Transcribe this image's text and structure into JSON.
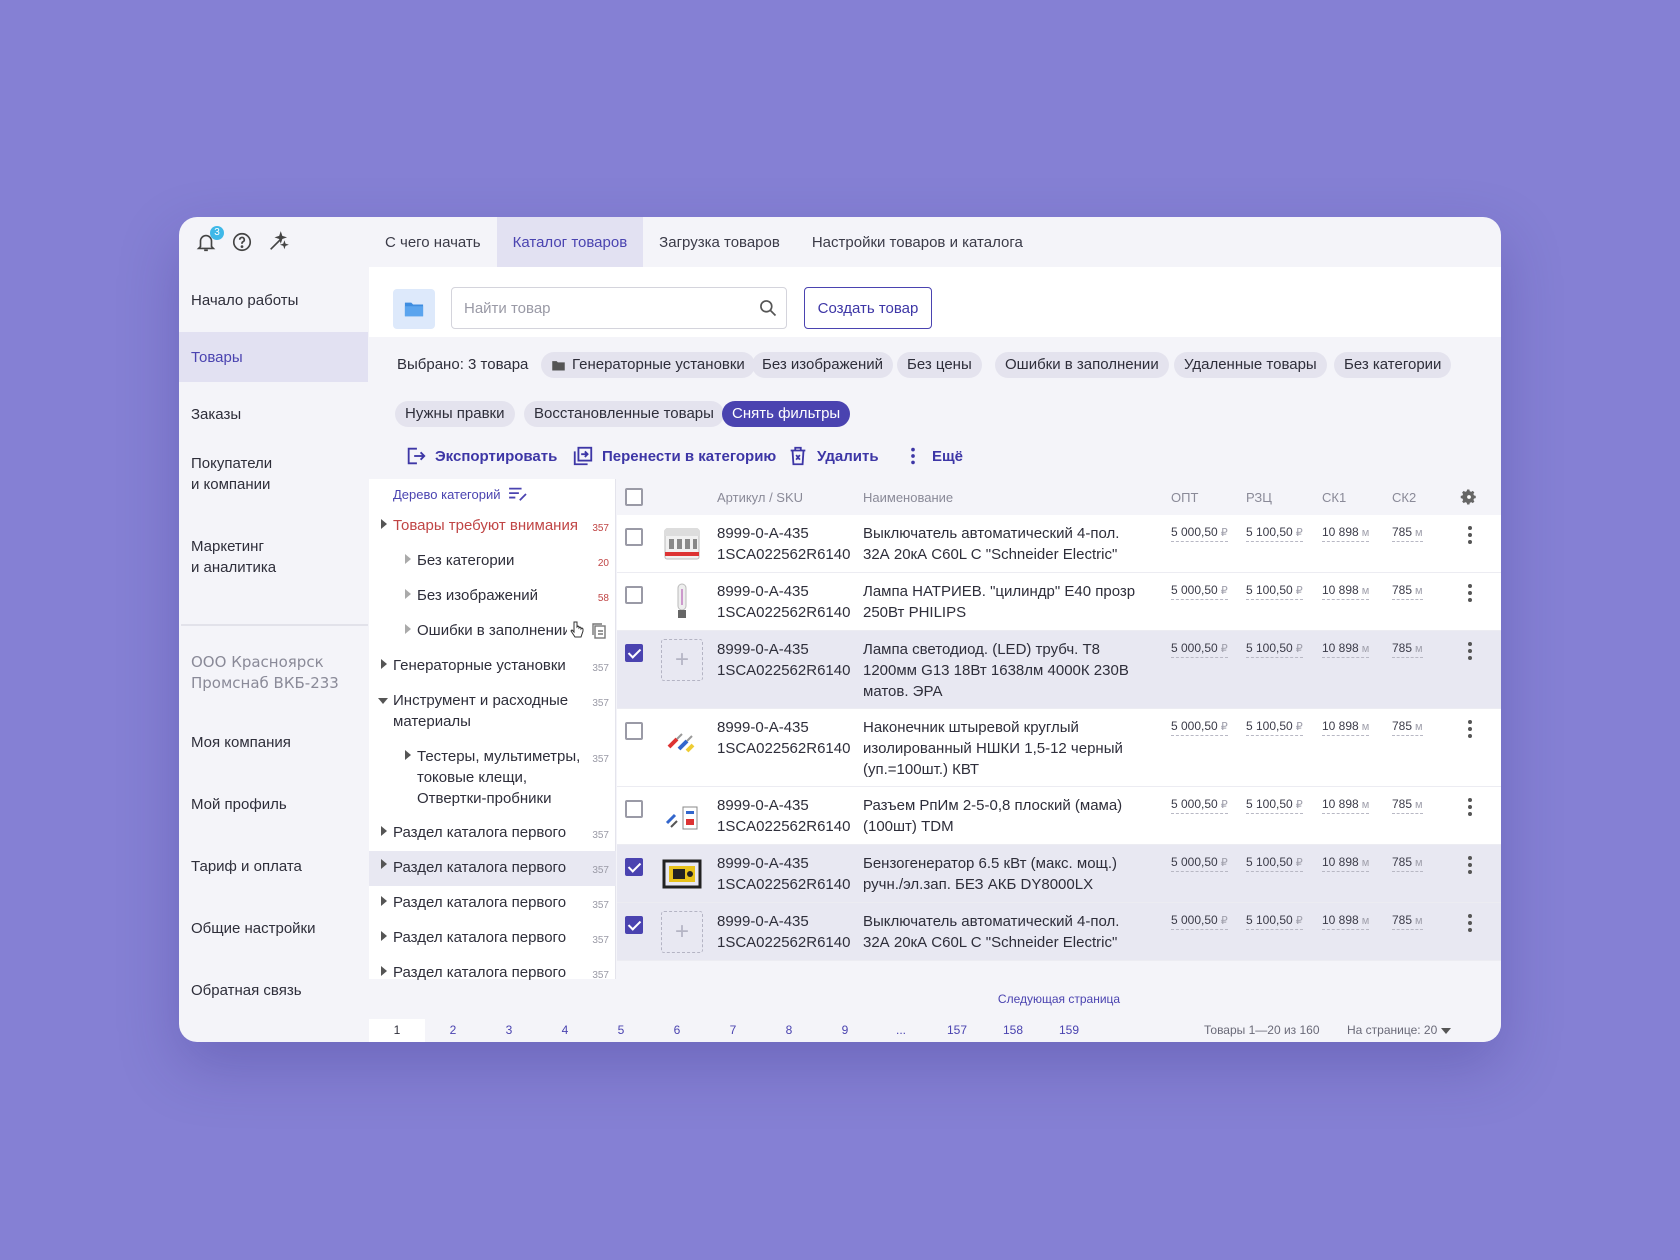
{
  "notifications": {
    "count": "3"
  },
  "tabs": [
    "С чего начать",
    "Каталог товаров",
    "Загрузка товаров",
    "Настройки товаров и каталога"
  ],
  "sidebar": {
    "items": [
      "Начало работы",
      "Товары",
      "Заказы",
      "Покупатели\nи компании",
      "Маркетинг\nи аналитика"
    ],
    "company": "ООО Красноярск\nПромснаб ВКБ-233",
    "bottom_items": [
      "Моя компания",
      "Мой профиль",
      "Тариф и оплата",
      "Общие настройки",
      "Обратная связь"
    ]
  },
  "search": {
    "placeholder": "Найти товар",
    "value": ""
  },
  "create_button": "Создать товар",
  "filters": {
    "selected": "Выбрано: 3 товара",
    "chips": [
      "Генераторные установки",
      "Без изображений",
      "Без цены",
      "Ошибки в заполнении",
      "Удаленные товары",
      "Без категории",
      "Нужны правки",
      "Восстановленные товары"
    ],
    "clear": "Снять фильтры"
  },
  "actions": [
    "Экспортировать",
    "Перенести в категорию",
    "Удалить",
    "Ещё"
  ],
  "tree": {
    "header": "Дерево категорий",
    "nodes": [
      {
        "label": "Товары требуют внимания",
        "count": "357"
      },
      {
        "label": "Без категории",
        "count": "20"
      },
      {
        "label": "Без изображений",
        "count": "58"
      },
      {
        "label": "Ошибки в заполнении",
        "count": ""
      },
      {
        "label": "Генераторные установки",
        "count": "357"
      },
      {
        "label": "Инструмент и расходные\nматериалы",
        "count": "357"
      },
      {
        "label": "Тестеры, мультиметры,\nтоковые клещи,\nОтвертки-пробники",
        "count": "357"
      },
      {
        "label": "Раздел каталога первого",
        "count": "357"
      },
      {
        "label": "Раздел каталога первого",
        "count": "357"
      },
      {
        "label": "Раздел каталога первого",
        "count": "357"
      },
      {
        "label": "Раздел каталога первого",
        "count": "357"
      },
      {
        "label": "Раздел каталога первого",
        "count": "357"
      }
    ]
  },
  "table": {
    "columns": [
      "Артикул / SKU",
      "Наименование",
      "ОПТ",
      "РЗЦ",
      "СК1",
      "СК2"
    ],
    "rows": [
      {
        "sku": "8999-0-A-435\n1SCA022562R6140",
        "name": "Выключатель автоматический 4-пол.\n32А 20кА C60L C \"Schneider Electric\"",
        "opt": "5 000,50",
        "rzc": "5 100,50",
        "sk1": "10 898",
        "sk2": "785",
        "selected": false
      },
      {
        "sku": "8999-0-A-435\n1SCA022562R6140",
        "name": "Лампа НАТРИЕВ. \"цилиндр\" E40 прозр\n250Вт PHILIPS",
        "opt": "5 000,50",
        "rzc": "5 100,50",
        "sk1": "10 898",
        "sk2": "785",
        "selected": false
      },
      {
        "sku": "8999-0-A-435\n1SCA022562R6140",
        "name": "Лампа светодиод. (LED) трубч. Т8\n1200мм G13 18Вт 1638лм 4000К 230В\nматов. ЭРА",
        "opt": "5 000,50",
        "rzc": "5 100,50",
        "sk1": "10 898",
        "sk2": "785",
        "selected": true
      },
      {
        "sku": "8999-0-A-435\n1SCA022562R6140",
        "name": "Наконечник штыревой круглый\nизолированный НШКИ 1,5-12 черный\n(уп.=100шт.) КВТ",
        "opt": "5 000,50",
        "rzc": "5 100,50",
        "sk1": "10 898",
        "sk2": "785",
        "selected": false
      },
      {
        "sku": "8999-0-A-435\n1SCA022562R6140",
        "name": "Разъем РпИм 2-5-0,8 плоский (мама)\n(100шт) TDM",
        "opt": "5 000,50",
        "rzc": "5 100,50",
        "sk1": "10 898",
        "sk2": "785",
        "selected": false
      },
      {
        "sku": "8999-0-A-435\n1SCA022562R6140",
        "name": "Бензогенератор 6.5 кВт (макс. мощ.)\nручн./эл.зап. БЕЗ АКБ DY8000LX",
        "opt": "5 000,50",
        "rzc": "5 100,50",
        "sk1": "10 898",
        "sk2": "785",
        "selected": true
      },
      {
        "sku": "8999-0-A-435\n1SCA022562R6140",
        "name": "Выключатель автоматический 4-пол.\n32А 20кА C60L C \"Schneider Electric\"",
        "opt": "5 000,50",
        "rzc": "5 100,50",
        "sk1": "10 898",
        "sk2": "785",
        "selected": true
      }
    ],
    "currency": "₽",
    "unit": "м"
  },
  "next_page": "Следующая страница",
  "pager": {
    "pages": [
      "1",
      "2",
      "3",
      "4",
      "5",
      "6",
      "7",
      "8",
      "9",
      "...",
      "157",
      "158",
      "159"
    ],
    "current": "1",
    "info": "Товары 1—20 из 160",
    "per_page": "На странице: 20"
  },
  "colors": {
    "background": "#8580d4",
    "accent": "#4a43b0",
    "attention": "#c04545",
    "badge": "#3fb8e8"
  }
}
